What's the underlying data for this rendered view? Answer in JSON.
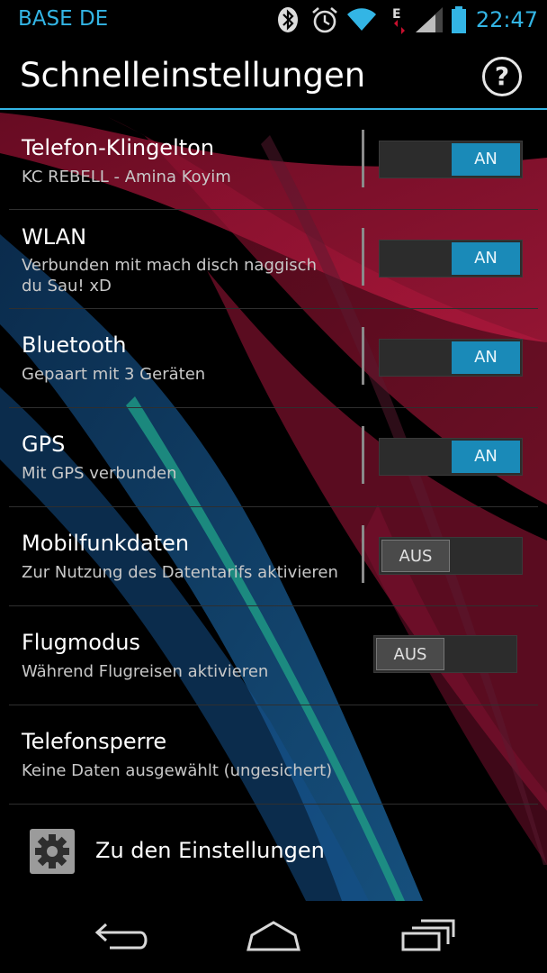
{
  "status_bar": {
    "carrier": "BASE DE",
    "time": "22:47",
    "icons": [
      "bluetooth-icon",
      "alarm-icon",
      "wifi-icon",
      "data-icon",
      "signal-icon",
      "battery-icon"
    ]
  },
  "action_bar": {
    "title": "Schnelleinstellungen",
    "help_label": "?"
  },
  "rows": [
    {
      "title": "Telefon-Klingelton",
      "subtitle": "KC REBELL - Amina Koyim",
      "toggle": "AN"
    },
    {
      "title": "WLAN",
      "subtitle": "Verbunden mit mach disch naggisch\ndu Sau!  xD",
      "toggle": "AN"
    },
    {
      "title": "Bluetooth",
      "subtitle": "Gepaart mit 3 Geräten",
      "toggle": "AN"
    },
    {
      "title": "GPS",
      "subtitle": "Mit GPS verbunden",
      "toggle": "AN"
    },
    {
      "title": "Mobilfunkdaten",
      "subtitle": "Zur Nutzung des Datentarifs aktivieren",
      "toggle": "AUS"
    },
    {
      "title": "Flugmodus",
      "subtitle": "Während Flugreisen aktivieren",
      "toggle": "AUS"
    },
    {
      "title": "Telefonsperre",
      "subtitle": "Keine Daten ausgewählt (ungesichert)"
    }
  ],
  "settings_link": {
    "label": "Zu den Einstellungen",
    "icon": "gear-icon"
  },
  "navigation": {
    "buttons": [
      "back-icon",
      "home-icon",
      "recent-apps-icon"
    ]
  },
  "colors": {
    "accent": "#33b5e5",
    "toggle_on": "#1a8ab8",
    "wallpaper_red": "#b0183c",
    "wallpaper_blue": "#1c5e9c",
    "wallpaper_teal": "#1c8c7c"
  }
}
